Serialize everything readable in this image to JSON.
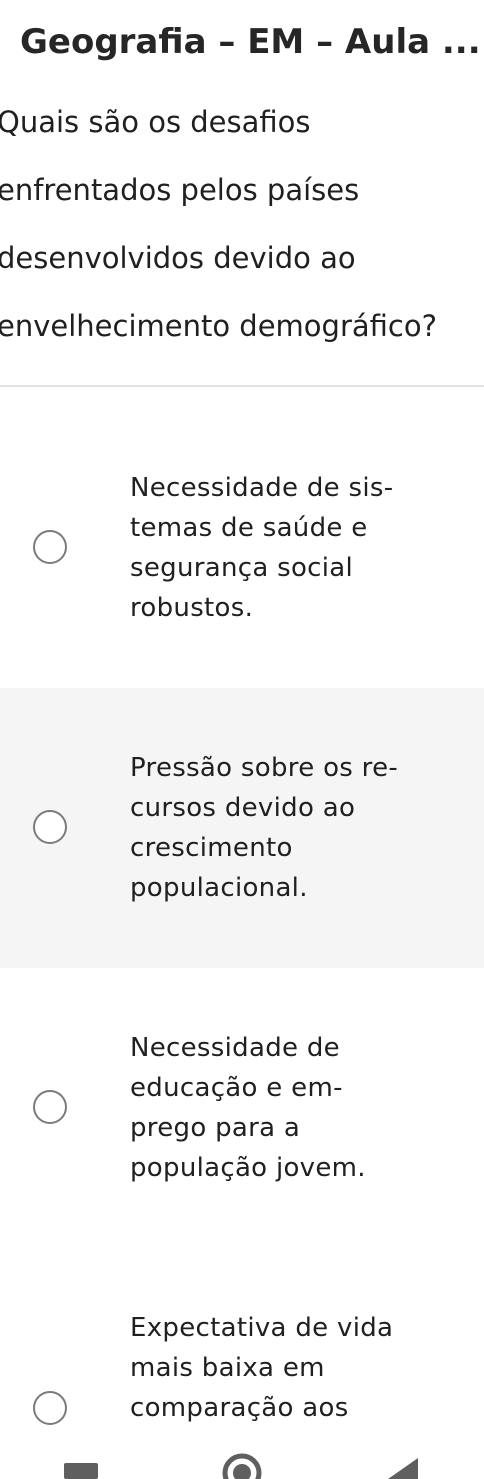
{
  "header": {
    "title": "Geografia – EM – Aula ..."
  },
  "question": {
    "lines": [
      "Quais são os desafios",
      "enfrentados pelos países",
      "desenvolvidos devido ao",
      "envelhecimento demográfico?"
    ]
  },
  "options": [
    {
      "lines": [
        "Necessidade de sis-",
        "temas de saúde e",
        "segurança social",
        "robustos."
      ],
      "selected": false
    },
    {
      "lines": [
        "Pressão sobre os re-",
        "cursos devido ao",
        "crescimento",
        "populacional."
      ],
      "selected": false
    },
    {
      "lines": [
        "Necessidade de",
        "educação e em-",
        "prego para a",
        "população jovem."
      ],
      "selected": false
    },
    {
      "lines": [
        "Expectativa de vida",
        "mais baixa em",
        "comparação aos"
      ],
      "selected": false
    }
  ],
  "navbar": {
    "icons": [
      "recents-icon",
      "home-icon",
      "back-icon"
    ]
  },
  "colors": {
    "text": "#202020",
    "radio_border": "#7b7b7b",
    "shaded_background": "#f5f5f5",
    "divider": "#e2e2e2",
    "nav_icons": "#5f5f5f"
  }
}
